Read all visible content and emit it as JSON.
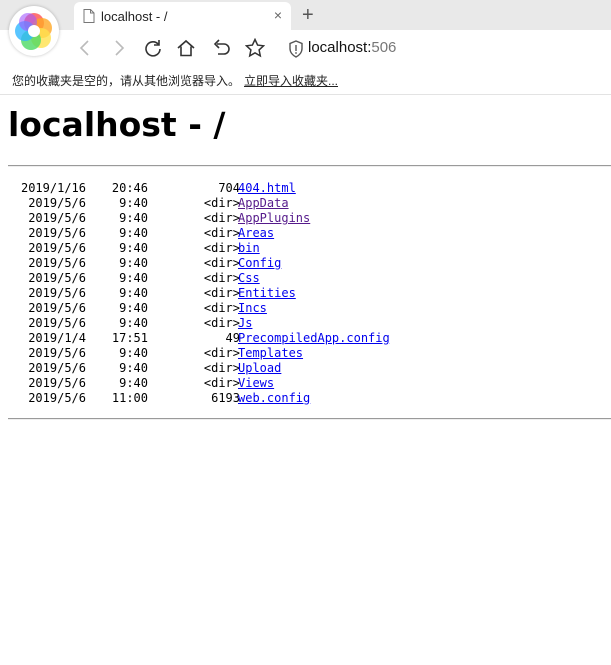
{
  "browser": {
    "tab_title": "localhost - /",
    "tab_close": "×",
    "new_tab": "+",
    "url_host": "localhost:",
    "url_port": "506",
    "bookmarks_message": "您的收藏夹是空的，请从其他浏览器导入。",
    "bookmarks_import_link": "立即导入收藏夹..."
  },
  "page": {
    "heading": "localhost - /",
    "entries": [
      {
        "date": "2019/1/16",
        "time": "20:46",
        "size": "704",
        "name": "404.html"
      },
      {
        "date": "2019/5/6",
        "time": "9:40",
        "size": "<dir>",
        "name": "AppData"
      },
      {
        "date": "2019/5/6",
        "time": "9:40",
        "size": "<dir>",
        "name": "AppPlugins"
      },
      {
        "date": "2019/5/6",
        "time": "9:40",
        "size": "<dir>",
        "name": "Areas"
      },
      {
        "date": "2019/5/6",
        "time": "9:40",
        "size": "<dir>",
        "name": "bin"
      },
      {
        "date": "2019/5/6",
        "time": "9:40",
        "size": "<dir>",
        "name": "Config"
      },
      {
        "date": "2019/5/6",
        "time": "9:40",
        "size": "<dir>",
        "name": "Css"
      },
      {
        "date": "2019/5/6",
        "time": "9:40",
        "size": "<dir>",
        "name": "Entities"
      },
      {
        "date": "2019/5/6",
        "time": "9:40",
        "size": "<dir>",
        "name": "Incs"
      },
      {
        "date": "2019/5/6",
        "time": "9:40",
        "size": "<dir>",
        "name": "Js"
      },
      {
        "date": "2019/1/4",
        "time": "17:51",
        "size": "49",
        "name": "PrecompiledApp.config"
      },
      {
        "date": "2019/5/6",
        "time": "9:40",
        "size": "<dir>",
        "name": "Templates"
      },
      {
        "date": "2019/5/6",
        "time": "9:40",
        "size": "<dir>",
        "name": "Upload"
      },
      {
        "date": "2019/5/6",
        "time": "9:40",
        "size": "<dir>",
        "name": "Views"
      },
      {
        "date": "2019/5/6",
        "time": "11:00",
        "size": "6193",
        "name": "web.config"
      }
    ]
  },
  "icons": [
    "browser-logo-icon",
    "page-icon",
    "back-icon",
    "forward-icon",
    "reload-icon",
    "home-icon",
    "undo-icon",
    "star-icon",
    "shield-icon"
  ],
  "colors": {
    "link": "#0000ee",
    "visited_link": "#551a8b",
    "tabstrip": "#e9e9e9"
  }
}
